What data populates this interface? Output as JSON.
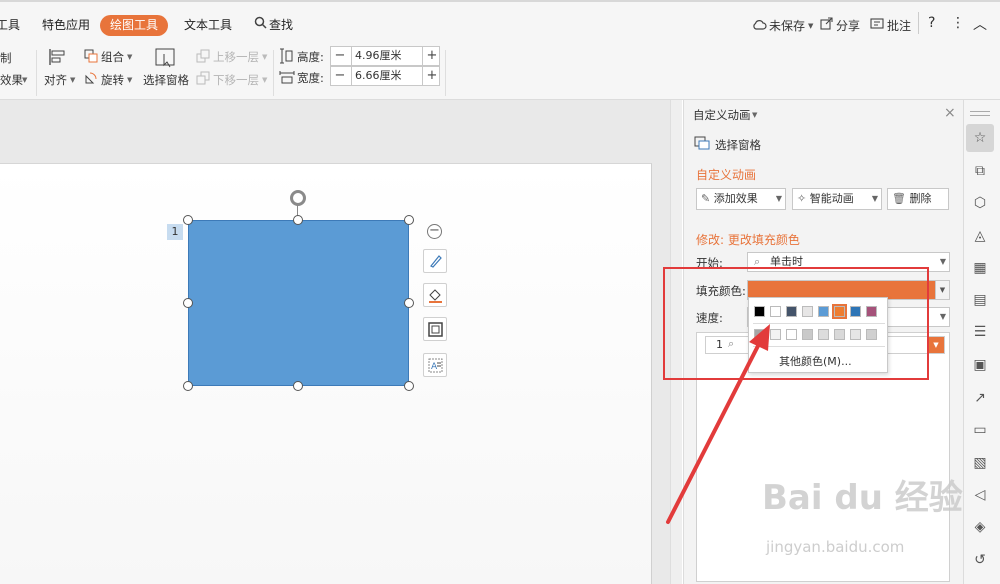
{
  "tabs": {
    "partial_left": "工具",
    "special": "特色应用",
    "drawing": "绘图工具",
    "text": "文本工具",
    "search": "查找"
  },
  "top_right": {
    "unsaved": "未保存",
    "share": "分享",
    "comment": "批注",
    "help": "?",
    "more": "⋮",
    "collapse": "︿"
  },
  "ribbon": {
    "partial_1": "制",
    "partial_2": "效果",
    "align": "对齐",
    "group": "组合",
    "rotate": "旋转",
    "select_pane": "选择窗格",
    "bring_forward": "上移一层",
    "send_backward": "下移一层",
    "height_label": "高度:",
    "height_value": "4.96厘米",
    "width_label": "宽度:",
    "width_value": "6.66厘米"
  },
  "slide": {
    "anim_number": "1"
  },
  "panel": {
    "header": "自定义动画",
    "select_pane": "选择窗格",
    "section_title": "自定义动画",
    "add_effect": "添加效果",
    "smart_anim": "智能动画",
    "delete": "删除",
    "modify_title": "修改: 更改填充颜色",
    "start_label": "开始:",
    "start_value": "单击时",
    "fill_label": "填充颜色:",
    "speed_label": "速度:",
    "list_number": "1",
    "more_colors": "其他颜色(M)..."
  },
  "colors": {
    "accent": "#e8743b",
    "shape_fill": "#5b9bd5",
    "annotation": "#e23b3b",
    "palette_row1": [
      "#000000",
      "#ffffff",
      "#44546a",
      "#e7e6e6",
      "#5b9bd5",
      "#ed7d31",
      "#2e75b6",
      "#a5527a"
    ],
    "palette_row2": [
      "#a6a6a6",
      "#f2f2f2",
      "#ffffff",
      "#c9c9c9",
      "#dcdcdc",
      "#d9d9d9",
      "#e6e6e6",
      "#d0d0d0"
    ]
  },
  "watermark": {
    "brand": "Bai du 经验",
    "url": "jingyan.baidu.com"
  }
}
